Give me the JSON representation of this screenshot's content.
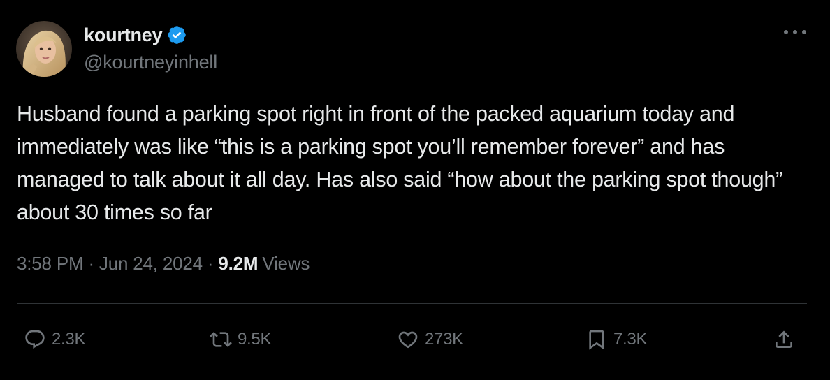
{
  "author": {
    "display_name": "kourtney",
    "handle": "@kourtneyinhell",
    "verified": true
  },
  "tweet": {
    "text": "Husband found a parking spot right in front of the packed aquarium today and immediately was like “this is a parking spot you’ll remember forever” and has managed to talk about it all day. Has also said “how about the parking spot though” about 30 times so far",
    "time": "3:58 PM",
    "separator": "·",
    "date": "Jun 24, 2024",
    "views_count": "9.2M",
    "views_label": "Views"
  },
  "actions": {
    "replies": "2.3K",
    "reposts": "9.5K",
    "likes": "273K",
    "bookmarks": "7.3K"
  },
  "icons": {
    "more": "more-horizontal-icon",
    "verified": "verified-badge-icon",
    "reply": "reply-icon",
    "repost": "repost-icon",
    "like": "heart-icon",
    "bookmark": "bookmark-icon",
    "share": "share-icon"
  },
  "colors": {
    "background": "#000000",
    "text_primary": "#e7e9ea",
    "text_secondary": "#71767b",
    "divider": "#2f3336",
    "verified_blue": "#1d9bf0"
  }
}
